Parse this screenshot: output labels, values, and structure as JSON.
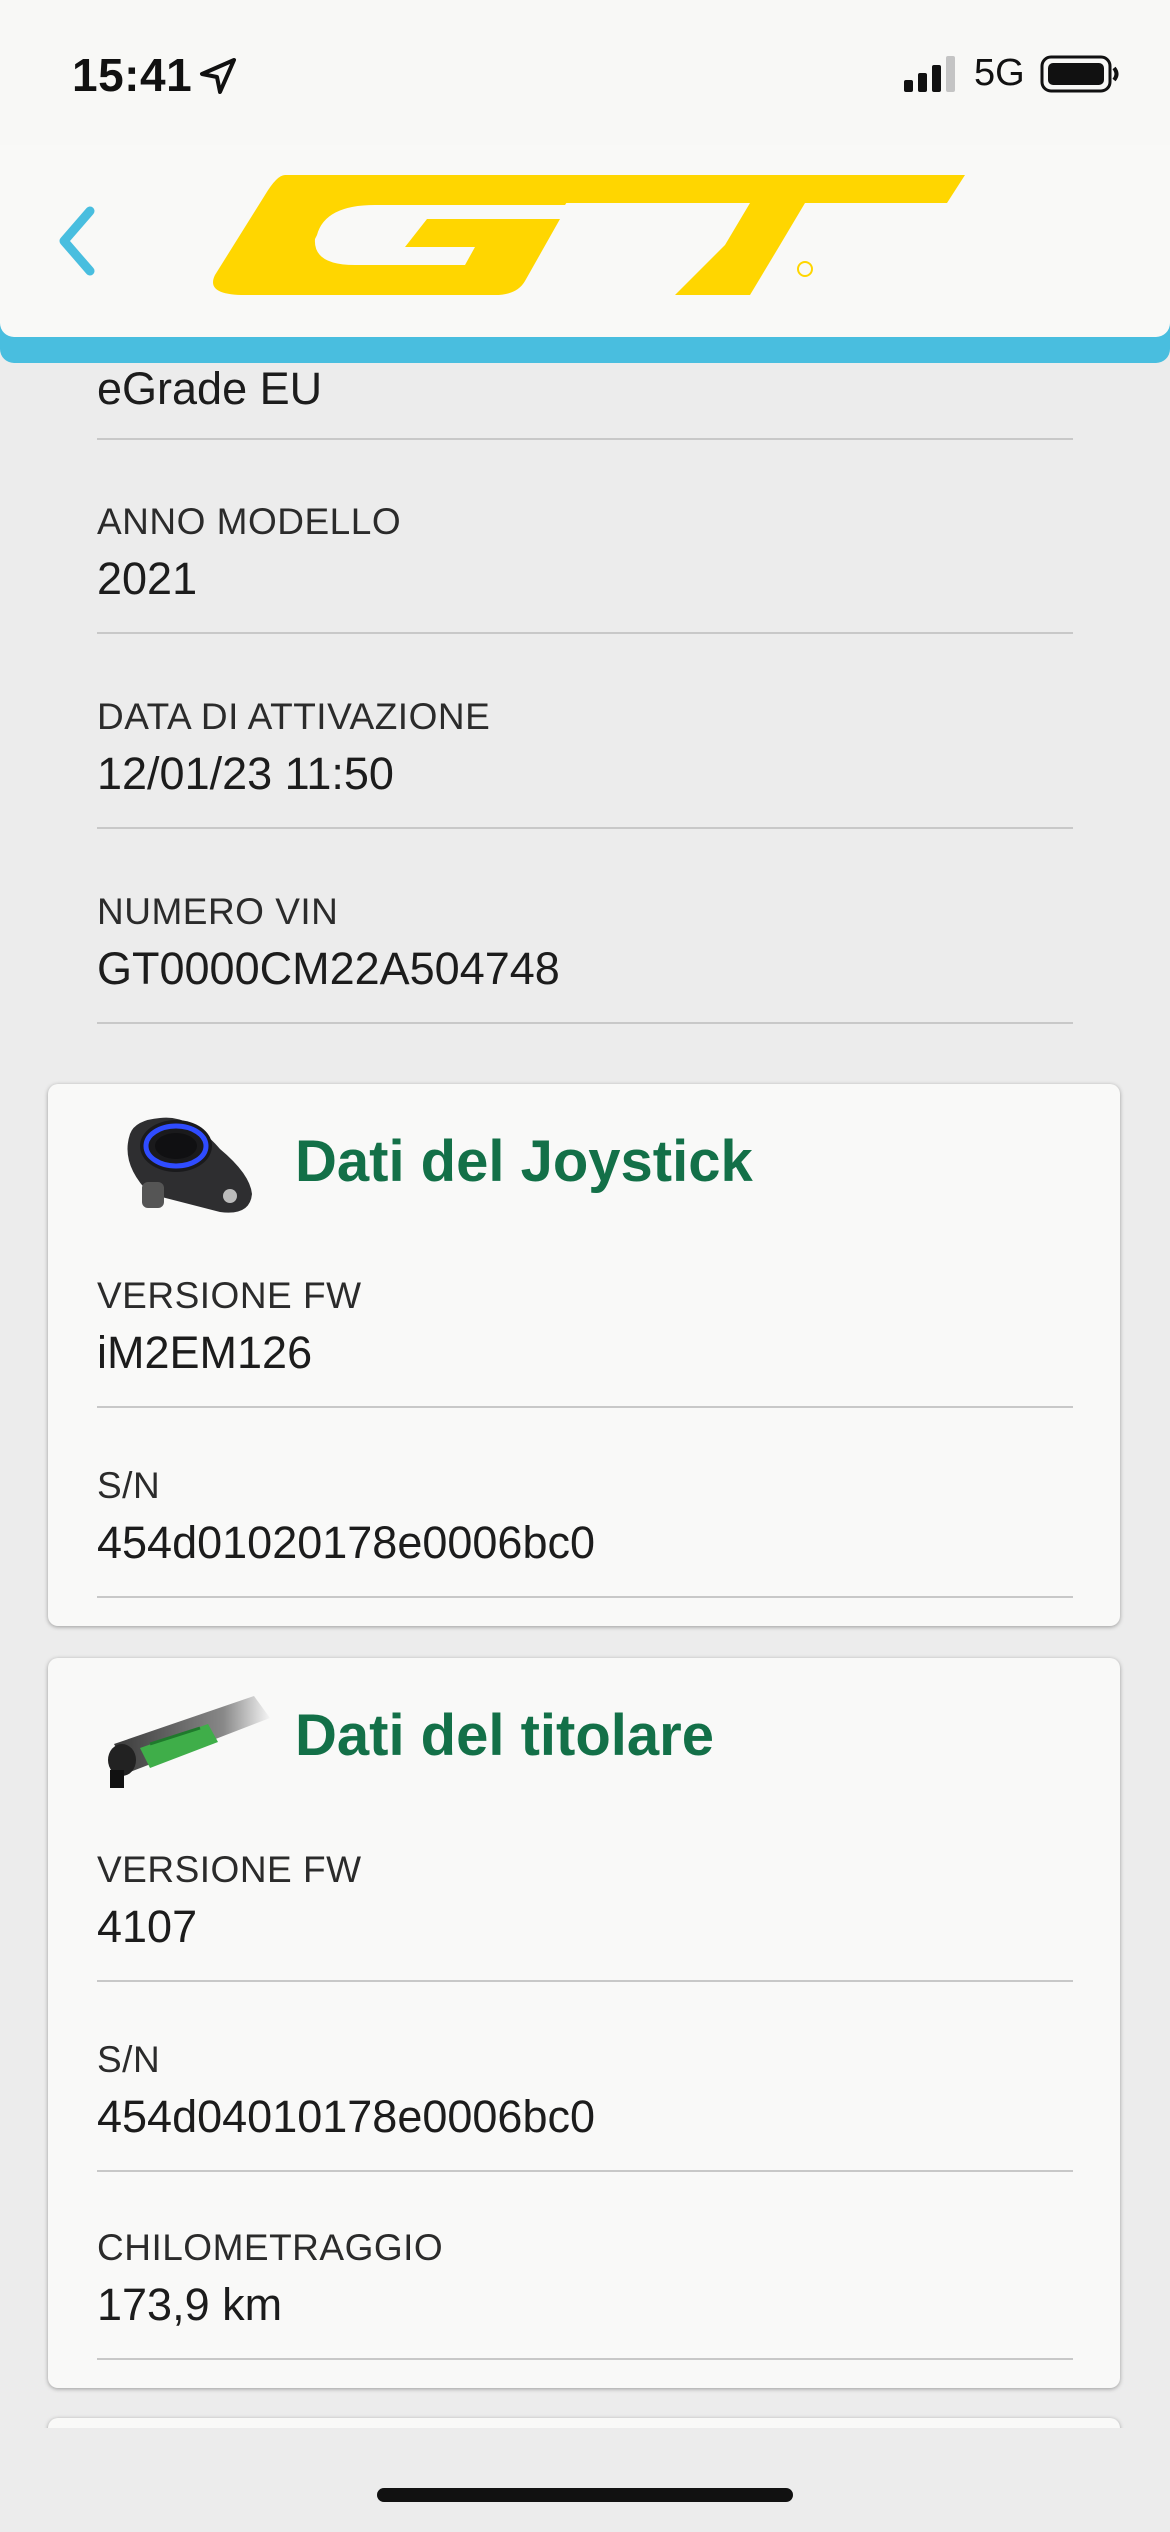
{
  "status_bar": {
    "time": "15:41",
    "network": "5G"
  },
  "header": {
    "brand": "GT"
  },
  "bike_info": {
    "model_value": "eGrade EU",
    "fields": [
      {
        "label": "ANNO MODELLO",
        "value": "2021"
      },
      {
        "label": "DATA DI ATTIVAZIONE",
        "value": "12/01/23 11:50"
      },
      {
        "label": "NUMERO VIN",
        "value": "GT0000CM22A504748"
      }
    ]
  },
  "joystick_card": {
    "title": "Dati del Joystick",
    "fields": [
      {
        "label": "VERSIONE FW",
        "value": "iM2EM126"
      },
      {
        "label": "S/N",
        "value": "454d01020178e0006bc0"
      }
    ]
  },
  "owner_card": {
    "title": "Dati del titolare",
    "fields": [
      {
        "label": "VERSIONE FW",
        "value": "4107"
      },
      {
        "label": "S/N",
        "value": "454d04010178e0006bc0"
      },
      {
        "label": "CHILOMETRAGGIO",
        "value": "173,9 km"
      }
    ]
  },
  "colors": {
    "accent": "#49bedf",
    "title_green": "#137048",
    "logo_yellow": "#ffd600"
  },
  "icons": [
    "location-arrow-icon",
    "signal-icon",
    "battery-icon",
    "back-chevron-icon",
    "joystick-icon",
    "battery-pack-icon"
  ]
}
